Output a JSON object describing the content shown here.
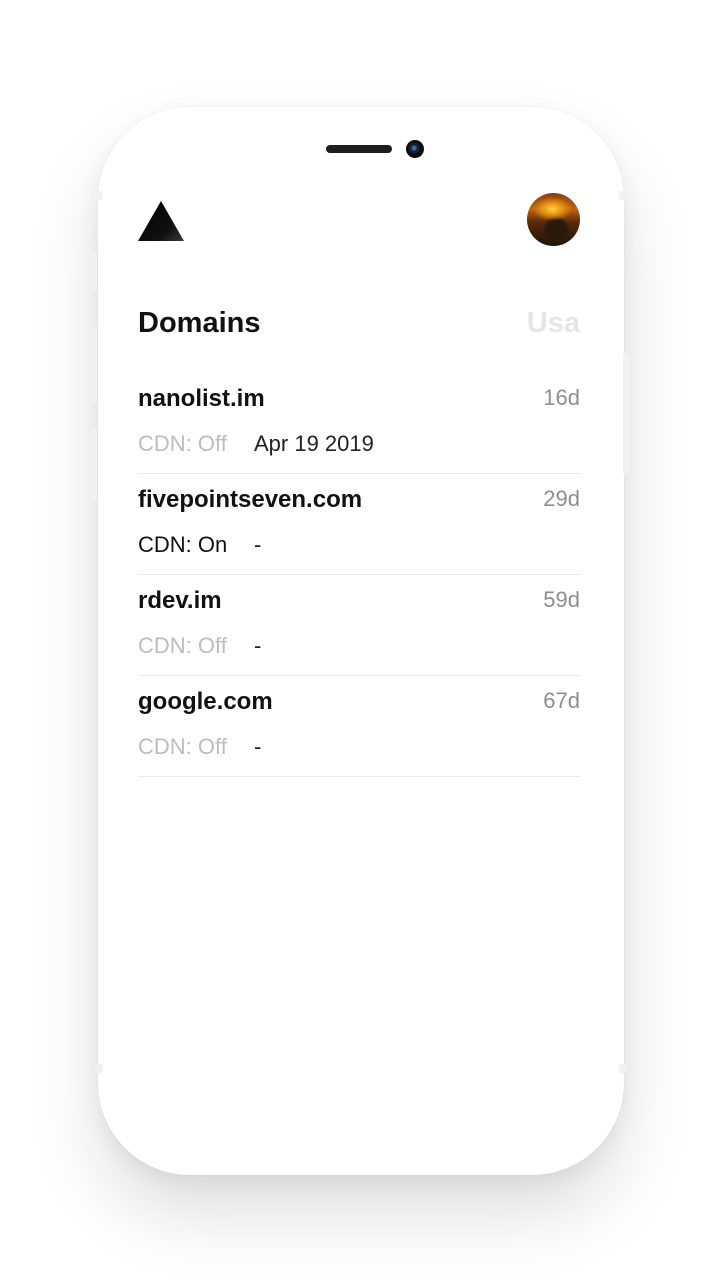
{
  "header": {
    "logo_icon": "triangle-logo-icon",
    "avatar_icon": "user-avatar"
  },
  "section": {
    "title": "Domains",
    "region": "Usa"
  },
  "domains": [
    {
      "name": "nanolist.im",
      "age": "16d",
      "cdn": "CDN: Off",
      "date": "Apr 19 2019"
    },
    {
      "name": "fivepointseven.com",
      "age": "29d",
      "cdn": "CDN: On",
      "date": "-"
    },
    {
      "name": "rdev.im",
      "age": "59d",
      "cdn": "CDN: Off",
      "date": "-"
    },
    {
      "name": "google.com",
      "age": "67d",
      "cdn": "CDN: Off",
      "date": "-"
    }
  ],
  "colors": {
    "text_primary": "#111111",
    "text_muted": "#bdbdbd",
    "age_text": "#8e8e8e",
    "region_text": "#e5e5e5"
  }
}
